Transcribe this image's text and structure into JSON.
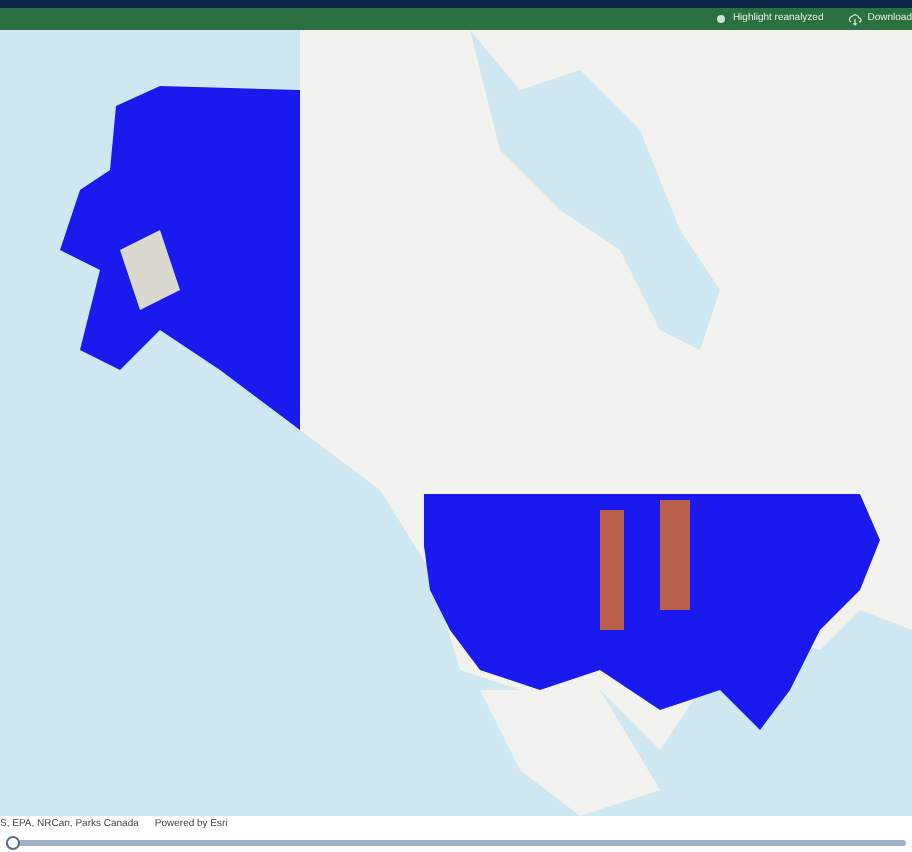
{
  "toolbar": {
    "buttons": [
      {
        "kind": "highlight",
        "label": "Highlight reanalyzed"
      },
      {
        "kind": "download",
        "label": "Download"
      }
    ]
  },
  "attribution": {
    "sources": "S, EPA, NRCan, Parks Canada",
    "powered_by": "Powered by Esri"
  },
  "time_slider": {
    "level": 0
  }
}
